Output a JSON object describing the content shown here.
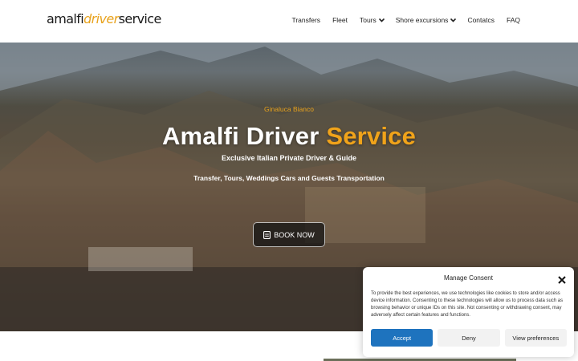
{
  "header": {
    "logo": {
      "part1": "amalfi",
      "part2": "driver",
      "part3": "service"
    },
    "nav": [
      {
        "label": "Transfers",
        "dropdown": false
      },
      {
        "label": "Fleet",
        "dropdown": false
      },
      {
        "label": "Tours",
        "dropdown": true
      },
      {
        "label": "Shore excursions",
        "dropdown": true
      },
      {
        "label": "Contatcs",
        "dropdown": false
      },
      {
        "label": "FAQ",
        "dropdown": false
      }
    ]
  },
  "hero": {
    "author": "Ginaluca Bianco",
    "title_main": "Amalfi Driver ",
    "title_accent": "Service",
    "tagline": "Exclusive Italian Private Driver & Guide",
    "services": "Transfer, Tours, Weddings Cars and Guests Transportation",
    "book_label": "BOOK NOW",
    "book_icon": "calendar-icon"
  },
  "consent": {
    "title": "Manage Consent",
    "close_icon": "close-icon",
    "text": "To provide the best experiences, we use technologies like cookies to store and/or access device information. Consenting to these technologies will allow us to process data such as browsing behavior or unique IDs on this site. Not consenting or withdrawing consent, may adversely affect certain features and functions.",
    "accept": "Accept",
    "deny": "Deny",
    "preferences": "View preferences"
  },
  "colors": {
    "accent": "#f0a31a",
    "button_blue": "#1e73be"
  }
}
